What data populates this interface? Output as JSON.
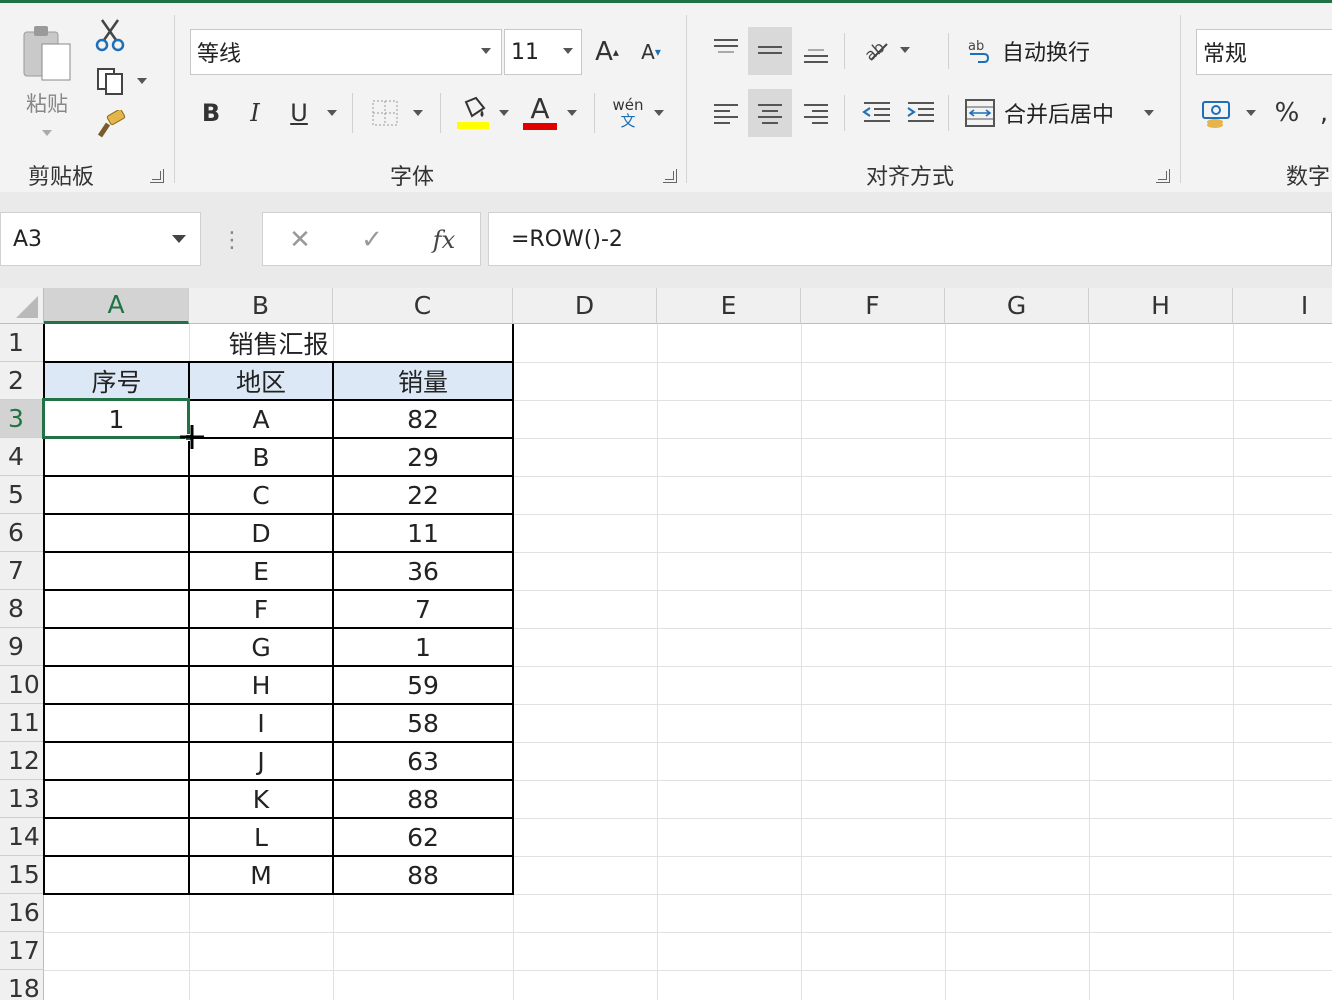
{
  "ribbon": {
    "clipboard": {
      "paste_label": "粘贴",
      "group_label": "剪贴板"
    },
    "font": {
      "font_name": "等线",
      "font_size": "11",
      "bold": "B",
      "italic": "I",
      "underline": "U",
      "phonetic_top": "wén",
      "phonetic_bottom": "文",
      "group_label": "字体",
      "highlight_color": "#ffff00",
      "font_color": "#e00000"
    },
    "alignment": {
      "wrap_text": "自动换行",
      "merge_center": "合并后居中",
      "group_label": "对齐方式"
    },
    "number": {
      "format": "常规",
      "percent": "%",
      "group_label": "数字"
    }
  },
  "formula_bar": {
    "name_box": "A3",
    "formula": "=ROW()-2",
    "fx": "fx"
  },
  "sheet": {
    "columns": [
      "A",
      "B",
      "C",
      "D",
      "E",
      "F",
      "G",
      "H",
      "I"
    ],
    "rows": [
      "1",
      "2",
      "3",
      "4",
      "5",
      "6",
      "7",
      "8",
      "9",
      "10",
      "11",
      "12",
      "13",
      "14",
      "15",
      "16",
      "17",
      "18"
    ],
    "title": "销售汇报",
    "headers": [
      "序号",
      "地区",
      "销量"
    ],
    "header_fill": "#dde8f6",
    "data": [
      {
        "seq": "1",
        "region": "A",
        "sales": "82"
      },
      {
        "seq": "",
        "region": "B",
        "sales": "29"
      },
      {
        "seq": "",
        "region": "C",
        "sales": "22"
      },
      {
        "seq": "",
        "region": "D",
        "sales": "11"
      },
      {
        "seq": "",
        "region": "E",
        "sales": "36"
      },
      {
        "seq": "",
        "region": "F",
        "sales": "7"
      },
      {
        "seq": "",
        "region": "G",
        "sales": "1"
      },
      {
        "seq": "",
        "region": "H",
        "sales": "59"
      },
      {
        "seq": "",
        "region": "I",
        "sales": "58"
      },
      {
        "seq": "",
        "region": "J",
        "sales": "63"
      },
      {
        "seq": "",
        "region": "K",
        "sales": "88"
      },
      {
        "seq": "",
        "region": "L",
        "sales": "62"
      },
      {
        "seq": "",
        "region": "M",
        "sales": "88"
      }
    ],
    "accent": "#217346"
  }
}
